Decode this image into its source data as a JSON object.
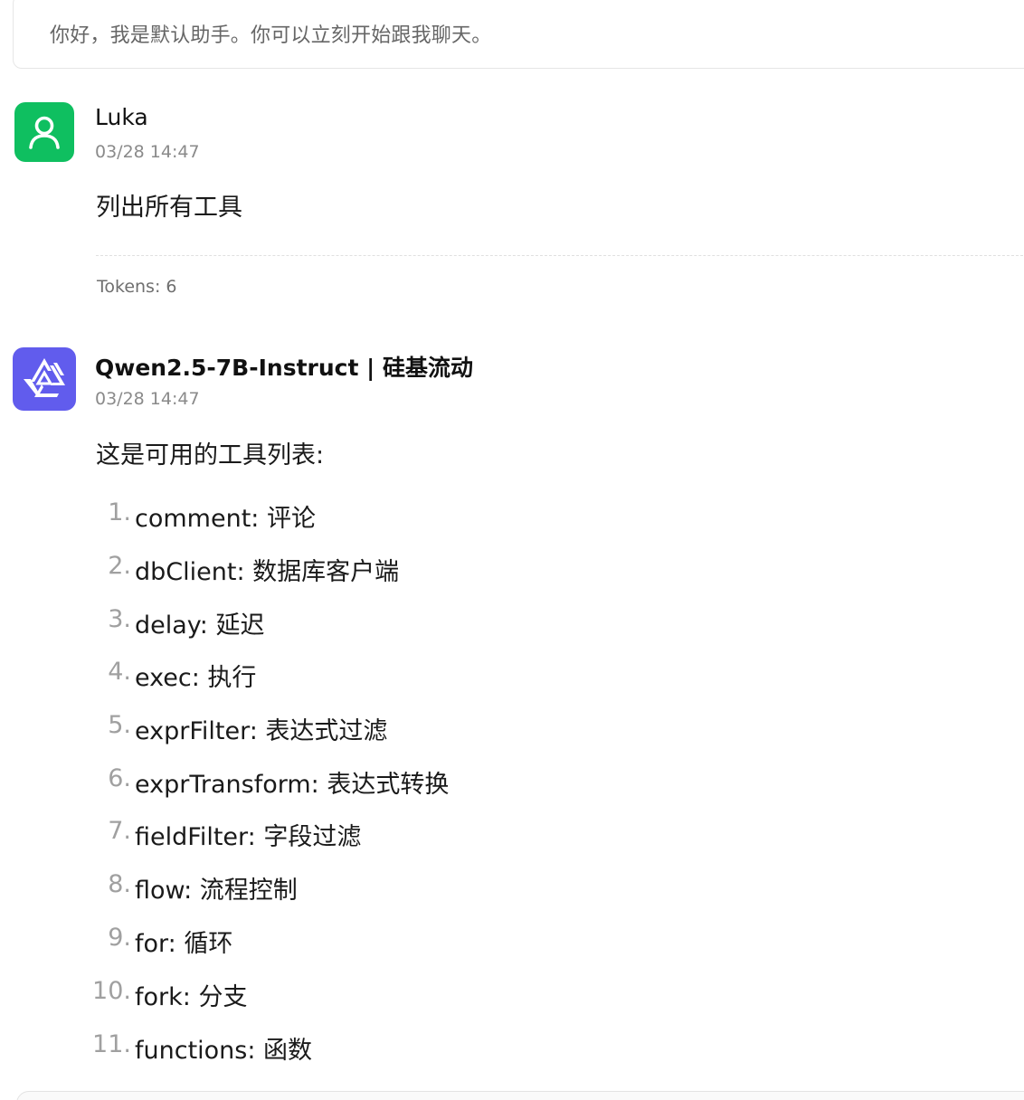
{
  "welcome": {
    "text": "你好，我是默认助手。你可以立刻开始跟我聊天。"
  },
  "user_message": {
    "avatar_icon": "user-icon",
    "avatar_color": "#0fbf60",
    "name": "Luka",
    "time": "03/28 14:47",
    "content": "列出所有工具",
    "tokens": "Tokens: 6"
  },
  "assistant_message": {
    "avatar_icon": "qwen-logo-icon",
    "avatar_color": "#615ced",
    "name": "Qwen2.5-7B-Instruct | 硅基流动",
    "time": "03/28 14:47",
    "intro": "这是可用的工具列表:",
    "tools": [
      {
        "num": "1.",
        "text": "comment: 评论"
      },
      {
        "num": "2.",
        "text": "dbClient: 数据库客户端"
      },
      {
        "num": "3.",
        "text": "delay: 延迟"
      },
      {
        "num": "4.",
        "text": "exec: 执行"
      },
      {
        "num": "5.",
        "text": "exprFilter: 表达式过滤"
      },
      {
        "num": "6.",
        "text": "exprTransform: 表达式转换"
      },
      {
        "num": "7.",
        "text": "fieldFilter: 字段过滤"
      },
      {
        "num": "8.",
        "text": "flow: 流程控制"
      },
      {
        "num": "9.",
        "text": "for: 循环"
      },
      {
        "num": "10.",
        "text": "fork: 分支"
      },
      {
        "num": "11.",
        "text": "functions: 函数"
      }
    ]
  }
}
